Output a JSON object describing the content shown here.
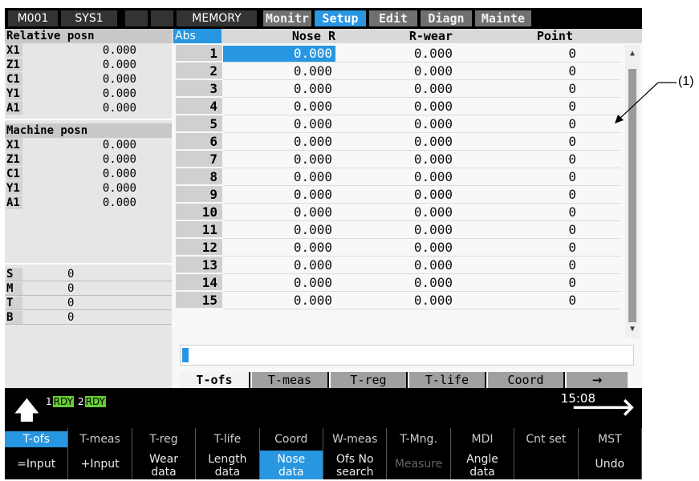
{
  "topbar": {
    "mode": "M001",
    "system": "SYS1",
    "op_mode": "MEMORY",
    "tabs": [
      {
        "label": "Monitr",
        "active": false
      },
      {
        "label": "Setup",
        "active": true
      },
      {
        "label": "Edit",
        "active": false
      },
      {
        "label": "Diagn",
        "active": false
      },
      {
        "label": "Mainte",
        "active": false
      }
    ]
  },
  "relative": {
    "title": "Relative posn",
    "rows": [
      {
        "axis": "X1",
        "value": "0.000"
      },
      {
        "axis": "Z1",
        "value": "0.000"
      },
      {
        "axis": "C1",
        "value": "0.000"
      },
      {
        "axis": "Y1",
        "value": "0.000"
      },
      {
        "axis": "A1",
        "value": "0.000"
      }
    ]
  },
  "machine": {
    "title": "Machine posn",
    "rows": [
      {
        "axis": "X1",
        "value": "0.000"
      },
      {
        "axis": "Z1",
        "value": "0.000"
      },
      {
        "axis": "C1",
        "value": "0.000"
      },
      {
        "axis": "Y1",
        "value": "0.000"
      },
      {
        "axis": "A1",
        "value": "0.000"
      }
    ]
  },
  "modal": {
    "rows": [
      {
        "label": "S",
        "value": "0"
      },
      {
        "label": "M",
        "value": "0"
      },
      {
        "label": "T",
        "value": "0"
      },
      {
        "label": "B",
        "value": "0"
      }
    ]
  },
  "table": {
    "abs_label": "Abs",
    "headers": [
      "Nose R",
      "R-wear",
      "Point"
    ],
    "rows": [
      {
        "no": "1",
        "nose_r": "0.000",
        "r_wear": "0.000",
        "point": "0"
      },
      {
        "no": "2",
        "nose_r": "0.000",
        "r_wear": "0.000",
        "point": "0"
      },
      {
        "no": "3",
        "nose_r": "0.000",
        "r_wear": "0.000",
        "point": "0"
      },
      {
        "no": "4",
        "nose_r": "0.000",
        "r_wear": "0.000",
        "point": "0"
      },
      {
        "no": "5",
        "nose_r": "0.000",
        "r_wear": "0.000",
        "point": "0"
      },
      {
        "no": "6",
        "nose_r": "0.000",
        "r_wear": "0.000",
        "point": "0"
      },
      {
        "no": "7",
        "nose_r": "0.000",
        "r_wear": "0.000",
        "point": "0"
      },
      {
        "no": "8",
        "nose_r": "0.000",
        "r_wear": "0.000",
        "point": "0"
      },
      {
        "no": "9",
        "nose_r": "0.000",
        "r_wear": "0.000",
        "point": "0"
      },
      {
        "no": "10",
        "nose_r": "0.000",
        "r_wear": "0.000",
        "point": "0"
      },
      {
        "no": "11",
        "nose_r": "0.000",
        "r_wear": "0.000",
        "point": "0"
      },
      {
        "no": "12",
        "nose_r": "0.000",
        "r_wear": "0.000",
        "point": "0"
      },
      {
        "no": "13",
        "nose_r": "0.000",
        "r_wear": "0.000",
        "point": "0"
      },
      {
        "no": "14",
        "nose_r": "0.000",
        "r_wear": "0.000",
        "point": "0"
      },
      {
        "no": "15",
        "nose_r": "0.000",
        "r_wear": "0.000",
        "point": "0"
      }
    ]
  },
  "bottom_tabs": [
    {
      "label": "T-ofs",
      "active": true
    },
    {
      "label": "T-meas",
      "active": false
    },
    {
      "label": "T-reg",
      "active": false
    },
    {
      "label": "T-life",
      "active": false
    },
    {
      "label": "Coord",
      "active": false
    },
    {
      "label": "→",
      "active": false
    }
  ],
  "status": {
    "rdy1_num": "1",
    "rdy1_label": "RDY",
    "rdy2_num": "2",
    "rdy2_label": "RDY",
    "time": "15:08"
  },
  "softkeys": [
    {
      "top": "T-ofs",
      "bottom": "=Input",
      "top_active": true,
      "bottom_active": false,
      "bottom_dim": false
    },
    {
      "top": "T-meas",
      "bottom": "+Input",
      "top_active": false,
      "bottom_active": false,
      "bottom_dim": false
    },
    {
      "top": "T-reg",
      "bottom": "Wear\ndata",
      "top_active": false,
      "bottom_active": false,
      "bottom_dim": false
    },
    {
      "top": "T-life",
      "bottom": "Length\ndata",
      "top_active": false,
      "bottom_active": false,
      "bottom_dim": false
    },
    {
      "top": "Coord",
      "bottom": "Nose\ndata",
      "top_active": false,
      "bottom_active": true,
      "bottom_dim": false
    },
    {
      "top": "W-meas",
      "bottom": "Ofs No\nsearch",
      "top_active": false,
      "bottom_active": false,
      "bottom_dim": false
    },
    {
      "top": "T-Mng.",
      "bottom": "Measure",
      "top_active": false,
      "bottom_active": false,
      "bottom_dim": true
    },
    {
      "top": "MDI",
      "bottom": "Angle\ndata",
      "top_active": false,
      "bottom_active": false,
      "bottom_dim": false
    },
    {
      "top": "Cnt set",
      "bottom": "",
      "top_active": false,
      "bottom_active": false,
      "bottom_dim": false
    },
    {
      "top": "MST",
      "bottom": "Undo",
      "top_active": false,
      "bottom_active": false,
      "bottom_dim": false
    }
  ],
  "callout": "(1)",
  "colors": {
    "accent": "#2896e0",
    "ready": "#66cc33"
  }
}
